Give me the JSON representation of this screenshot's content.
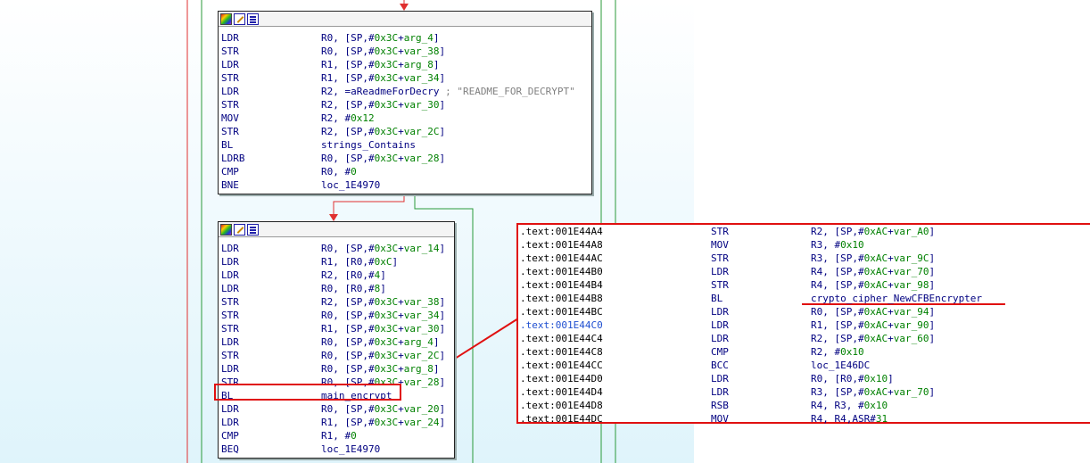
{
  "block1": {
    "lines": [
      {
        "mn": "LDR",
        "op": [
          {
            "t": "R0, [SP,#"
          },
          {
            "t": "0x3C",
            "c": "g"
          },
          {
            "t": "+"
          },
          {
            "t": "arg_4",
            "c": "g"
          },
          {
            "t": "]"
          }
        ]
      },
      {
        "mn": "STR",
        "op": [
          {
            "t": "R0, [SP,#"
          },
          {
            "t": "0x3C",
            "c": "g"
          },
          {
            "t": "+"
          },
          {
            "t": "var_38",
            "c": "g"
          },
          {
            "t": "]"
          }
        ]
      },
      {
        "mn": "LDR",
        "op": [
          {
            "t": "R1, [SP,#"
          },
          {
            "t": "0x3C",
            "c": "g"
          },
          {
            "t": "+"
          },
          {
            "t": "arg_8",
            "c": "g"
          },
          {
            "t": "]"
          }
        ]
      },
      {
        "mn": "STR",
        "op": [
          {
            "t": "R1, [SP,#"
          },
          {
            "t": "0x3C",
            "c": "g"
          },
          {
            "t": "+"
          },
          {
            "t": "var_34",
            "c": "g"
          },
          {
            "t": "]"
          }
        ]
      },
      {
        "mn": "LDR",
        "op": [
          {
            "t": "R2, =aReadmeForDecry "
          },
          {
            "t": "; \"README_FOR_DECRYPT\"",
            "c": "gr"
          }
        ]
      },
      {
        "mn": "STR",
        "op": [
          {
            "t": "R2, [SP,#"
          },
          {
            "t": "0x3C",
            "c": "g"
          },
          {
            "t": "+"
          },
          {
            "t": "var_30",
            "c": "g"
          },
          {
            "t": "]"
          }
        ]
      },
      {
        "mn": "MOV",
        "op": [
          {
            "t": "R2, #"
          },
          {
            "t": "0x12",
            "c": "g"
          }
        ]
      },
      {
        "mn": "STR",
        "op": [
          {
            "t": "R2, [SP,#"
          },
          {
            "t": "0x3C",
            "c": "g"
          },
          {
            "t": "+"
          },
          {
            "t": "var_2C",
            "c": "g"
          },
          {
            "t": "]"
          }
        ]
      },
      {
        "mn": "BL",
        "op": [
          {
            "t": "strings_Contains"
          }
        ]
      },
      {
        "mn": "LDRB",
        "op": [
          {
            "t": "R0, [SP,#"
          },
          {
            "t": "0x3C",
            "c": "g"
          },
          {
            "t": "+"
          },
          {
            "t": "var_28",
            "c": "g"
          },
          {
            "t": "]"
          }
        ]
      },
      {
        "mn": "CMP",
        "op": [
          {
            "t": "R0, #"
          },
          {
            "t": "0",
            "c": "g"
          }
        ]
      },
      {
        "mn": "BNE",
        "op": [
          {
            "t": "loc_1E4970"
          }
        ]
      }
    ]
  },
  "block2": {
    "lines": [
      {
        "mn": "LDR",
        "op": [
          {
            "t": "R0, [SP,#"
          },
          {
            "t": "0x3C",
            "c": "g"
          },
          {
            "t": "+"
          },
          {
            "t": "var_14",
            "c": "g"
          },
          {
            "t": "]"
          }
        ]
      },
      {
        "mn": "LDR",
        "op": [
          {
            "t": "R1, [R0,#"
          },
          {
            "t": "0xC",
            "c": "g"
          },
          {
            "t": "]"
          }
        ]
      },
      {
        "mn": "LDR",
        "op": [
          {
            "t": "R2, [R0,#"
          },
          {
            "t": "4",
            "c": "g"
          },
          {
            "t": "]"
          }
        ]
      },
      {
        "mn": "LDR",
        "op": [
          {
            "t": "R0, [R0,#"
          },
          {
            "t": "8",
            "c": "g"
          },
          {
            "t": "]"
          }
        ]
      },
      {
        "mn": "STR",
        "op": [
          {
            "t": "R2, [SP,#"
          },
          {
            "t": "0x3C",
            "c": "g"
          },
          {
            "t": "+"
          },
          {
            "t": "var_38",
            "c": "g"
          },
          {
            "t": "]"
          }
        ]
      },
      {
        "mn": "STR",
        "op": [
          {
            "t": "R0, [SP,#"
          },
          {
            "t": "0x3C",
            "c": "g"
          },
          {
            "t": "+"
          },
          {
            "t": "var_34",
            "c": "g"
          },
          {
            "t": "]"
          }
        ]
      },
      {
        "mn": "STR",
        "op": [
          {
            "t": "R1, [SP,#"
          },
          {
            "t": "0x3C",
            "c": "g"
          },
          {
            "t": "+"
          },
          {
            "t": "var_30",
            "c": "g"
          },
          {
            "t": "]"
          }
        ]
      },
      {
        "mn": "LDR",
        "op": [
          {
            "t": "R0, [SP,#"
          },
          {
            "t": "0x3C",
            "c": "g"
          },
          {
            "t": "+"
          },
          {
            "t": "arg_4",
            "c": "g"
          },
          {
            "t": "]"
          }
        ]
      },
      {
        "mn": "STR",
        "op": [
          {
            "t": "R0, [SP,#"
          },
          {
            "t": "0x3C",
            "c": "g"
          },
          {
            "t": "+"
          },
          {
            "t": "var_2C",
            "c": "g"
          },
          {
            "t": "]"
          }
        ]
      },
      {
        "mn": "LDR",
        "op": [
          {
            "t": "R0, [SP,#"
          },
          {
            "t": "0x3C",
            "c": "g"
          },
          {
            "t": "+"
          },
          {
            "t": "arg_8",
            "c": "g"
          },
          {
            "t": "]"
          }
        ]
      },
      {
        "mn": "STR",
        "op": [
          {
            "t": "R0, [SP,#"
          },
          {
            "t": "0x3C",
            "c": "g"
          },
          {
            "t": "+"
          },
          {
            "t": "var_28",
            "c": "g"
          },
          {
            "t": "]"
          }
        ]
      },
      {
        "mn": "BL",
        "op": [
          {
            "t": "main_encrypt"
          }
        ]
      },
      {
        "mn": "LDR",
        "op": [
          {
            "t": "R0, [SP,#"
          },
          {
            "t": "0x3C",
            "c": "g"
          },
          {
            "t": "+"
          },
          {
            "t": "var_20",
            "c": "g"
          },
          {
            "t": "]"
          }
        ]
      },
      {
        "mn": "LDR",
        "op": [
          {
            "t": "R1, [SP,#"
          },
          {
            "t": "0x3C",
            "c": "g"
          },
          {
            "t": "+"
          },
          {
            "t": "var_24",
            "c": "g"
          },
          {
            "t": "]"
          }
        ]
      },
      {
        "mn": "CMP",
        "op": [
          {
            "t": "R1, #"
          },
          {
            "t": "0",
            "c": "g"
          }
        ]
      },
      {
        "mn": "BEQ",
        "op": [
          {
            "t": "loc_1E4970"
          }
        ]
      }
    ]
  },
  "listing": {
    "rows": [
      {
        "addr": ".text:001E44A4",
        "mn": "STR",
        "op": [
          {
            "t": "R2, [SP,#"
          },
          {
            "t": "0xAC",
            "c": "g"
          },
          {
            "t": "+"
          },
          {
            "t": "var_A0",
            "c": "g"
          },
          {
            "t": "]"
          }
        ]
      },
      {
        "addr": ".text:001E44A8",
        "mn": "MOV",
        "op": [
          {
            "t": "R3, #"
          },
          {
            "t": "0x10",
            "c": "g"
          }
        ]
      },
      {
        "addr": ".text:001E44AC",
        "mn": "STR",
        "op": [
          {
            "t": "R3, [SP,#"
          },
          {
            "t": "0xAC",
            "c": "g"
          },
          {
            "t": "+"
          },
          {
            "t": "var_9C",
            "c": "g"
          },
          {
            "t": "]"
          }
        ]
      },
      {
        "addr": ".text:001E44B0",
        "mn": "LDR",
        "op": [
          {
            "t": "R4, [SP,#"
          },
          {
            "t": "0xAC",
            "c": "g"
          },
          {
            "t": "+"
          },
          {
            "t": "var_70",
            "c": "g"
          },
          {
            "t": "]"
          }
        ]
      },
      {
        "addr": ".text:001E44B4",
        "mn": "STR",
        "op": [
          {
            "t": "R4, [SP,#"
          },
          {
            "t": "0xAC",
            "c": "g"
          },
          {
            "t": "+"
          },
          {
            "t": "var_98",
            "c": "g"
          },
          {
            "t": "]"
          }
        ]
      },
      {
        "addr": ".text:001E44B8",
        "mn": "BL",
        "op": [
          {
            "t": "crypto_cipher_NewCFBEncrypter"
          }
        ]
      },
      {
        "addr": ".text:001E44BC",
        "mn": "LDR",
        "op": [
          {
            "t": "R0, [SP,#"
          },
          {
            "t": "0xAC",
            "c": "g"
          },
          {
            "t": "+"
          },
          {
            "t": "var_94",
            "c": "g"
          },
          {
            "t": "]"
          }
        ]
      },
      {
        "addr": ".text:001E44C0",
        "mn": "LDR",
        "op": [
          {
            "t": "R1, [SP,#"
          },
          {
            "t": "0xAC",
            "c": "g"
          },
          {
            "t": "+"
          },
          {
            "t": "var_90",
            "c": "g"
          },
          {
            "t": "]"
          }
        ],
        "hl": true
      },
      {
        "addr": ".text:001E44C4",
        "mn": "LDR",
        "op": [
          {
            "t": "R2, [SP,#"
          },
          {
            "t": "0xAC",
            "c": "g"
          },
          {
            "t": "+"
          },
          {
            "t": "var_60",
            "c": "g"
          },
          {
            "t": "]"
          }
        ]
      },
      {
        "addr": ".text:001E44C8",
        "mn": "CMP",
        "op": [
          {
            "t": "R2, #"
          },
          {
            "t": "0x10",
            "c": "g"
          }
        ]
      },
      {
        "addr": ".text:001E44CC",
        "mn": "BCC",
        "op": [
          {
            "t": "loc_1E46DC"
          }
        ]
      },
      {
        "addr": ".text:001E44D0",
        "mn": "LDR",
        "op": [
          {
            "t": "R0, [R0,#"
          },
          {
            "t": "0x10",
            "c": "g"
          },
          {
            "t": "]"
          }
        ]
      },
      {
        "addr": ".text:001E44D4",
        "mn": "LDR",
        "op": [
          {
            "t": "R3, [SP,#"
          },
          {
            "t": "0xAC",
            "c": "g"
          },
          {
            "t": "+"
          },
          {
            "t": "var_70",
            "c": "g"
          },
          {
            "t": "]"
          }
        ]
      },
      {
        "addr": ".text:001E44D8",
        "mn": "RSB",
        "op": [
          {
            "t": "R4, R3, #"
          },
          {
            "t": "0x10",
            "c": "g"
          }
        ]
      },
      {
        "addr": ".text:001E44DC",
        "mn": "MOV",
        "op": [
          {
            "t": "R4, R4,ASR#"
          },
          {
            "t": "31",
            "c": "g"
          }
        ]
      }
    ]
  },
  "colors": {
    "annotation": "#e01010",
    "edge_false": "#e03030",
    "edge_true": "#2a9a3a",
    "mnemonic": "#000080",
    "constant": "#008000"
  }
}
